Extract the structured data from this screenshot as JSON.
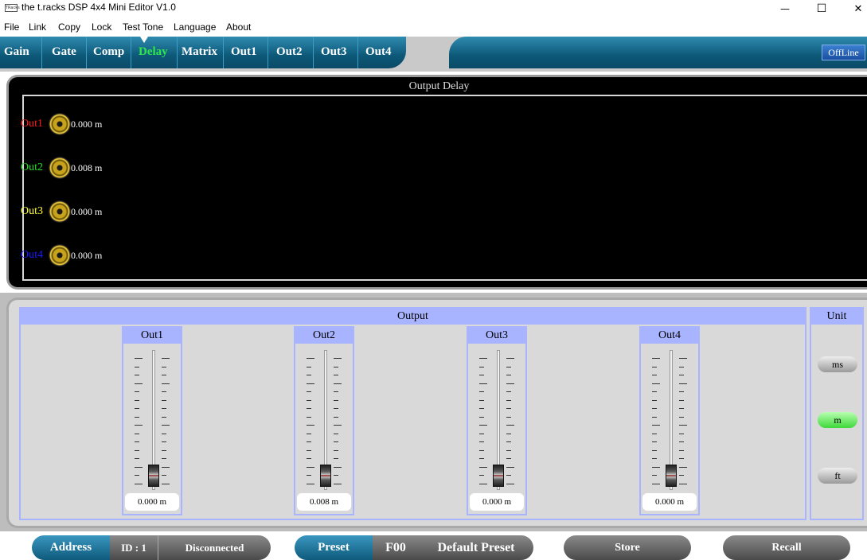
{
  "window": {
    "app_icon_text": "TRacks",
    "title": "the t.racks DSP 4x4 Mini Editor V1.0",
    "minimize_glyph": "—",
    "maximize_glyph": "☐",
    "close_glyph": "✕"
  },
  "menu": [
    "File",
    "Link",
    "Copy",
    "Lock",
    "Test Tone",
    "Language",
    "About"
  ],
  "tabs": [
    "Gain",
    "Gate",
    "Comp",
    "Delay",
    "Matrix",
    "Out1",
    "Out2",
    "Out3",
    "Out4"
  ],
  "active_tab": "Delay",
  "status": {
    "offline": "OffLine"
  },
  "delay_panel": {
    "title": "Output Delay",
    "outputs": [
      {
        "label": "Out1",
        "value": "0.000 m",
        "color": "#ff1a1a"
      },
      {
        "label": "Out2",
        "value": "0.008 m",
        "color": "#22e022"
      },
      {
        "label": "Out3",
        "value": "0.000 m",
        "color": "#ffff33"
      },
      {
        "label": "Out4",
        "value": "0.000 m",
        "color": "#1a1aff"
      }
    ]
  },
  "output_section": {
    "title": "Output",
    "channels": [
      {
        "name": "Out1",
        "value": "0.000 m"
      },
      {
        "name": "Out2",
        "value": "0.008 m"
      },
      {
        "name": "Out3",
        "value": "0.000 m"
      },
      {
        "name": "Out4",
        "value": "0.000 m"
      }
    ]
  },
  "unit_section": {
    "title": "Unit",
    "options": [
      "ms",
      "m",
      "ft"
    ],
    "selected": "m"
  },
  "footer": {
    "address_label": "Address",
    "id_label": "ID : 1",
    "connection_status": "Disconnected",
    "preset_label": "Preset",
    "preset_code": "F00",
    "preset_name": "Default Preset",
    "store_label": "Store",
    "recall_label": "Recall"
  }
}
